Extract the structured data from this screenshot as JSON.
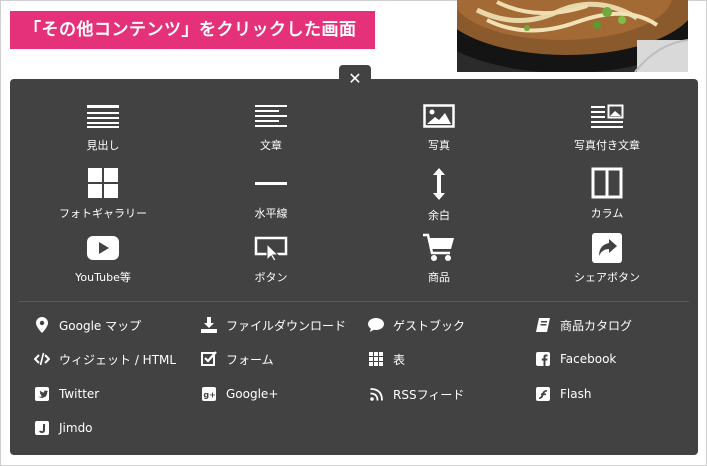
{
  "caption": "「その他コンテンツ」をクリックした画面",
  "close_glyph": "✕",
  "tiles": [
    {
      "label": "見出し",
      "icon": "heading-icon"
    },
    {
      "label": "文章",
      "icon": "text-icon"
    },
    {
      "label": "写真",
      "icon": "photo-icon"
    },
    {
      "label": "写真付き文章",
      "icon": "photo-text-icon"
    },
    {
      "label": "フォトギャラリー",
      "icon": "gallery-icon"
    },
    {
      "label": "水平線",
      "icon": "horizontal-line-icon"
    },
    {
      "label": "余白",
      "icon": "spacing-icon"
    },
    {
      "label": "カラム",
      "icon": "column-icon"
    },
    {
      "label": "YouTube等",
      "icon": "youtube-icon"
    },
    {
      "label": "ボタン",
      "icon": "button-icon"
    },
    {
      "label": "商品",
      "icon": "cart-icon"
    },
    {
      "label": "シェアボタン",
      "icon": "share-icon"
    }
  ],
  "links": [
    {
      "label": "Google マップ",
      "icon": "map-pin-icon"
    },
    {
      "label": "ファイルダウンロード",
      "icon": "download-icon"
    },
    {
      "label": "ゲストブック",
      "icon": "comment-icon"
    },
    {
      "label": "商品カタログ",
      "icon": "catalog-icon"
    },
    {
      "label": "ウィジェット / HTML",
      "icon": "code-icon"
    },
    {
      "label": "フォーム",
      "icon": "checkbox-icon"
    },
    {
      "label": "表",
      "icon": "table-icon"
    },
    {
      "label": "Facebook",
      "icon": "facebook-icon"
    },
    {
      "label": "Twitter",
      "icon": "twitter-icon"
    },
    {
      "label": "Google+",
      "icon": "google-plus-icon"
    },
    {
      "label": "RSSフィード",
      "icon": "rss-icon"
    },
    {
      "label": "Flash",
      "icon": "flash-icon"
    },
    {
      "label": "Jimdo",
      "icon": "jimdo-icon"
    }
  ],
  "colors": {
    "caption_bg": "#e5307a",
    "panel_bg": "#424242",
    "text": "#ffffff"
  }
}
